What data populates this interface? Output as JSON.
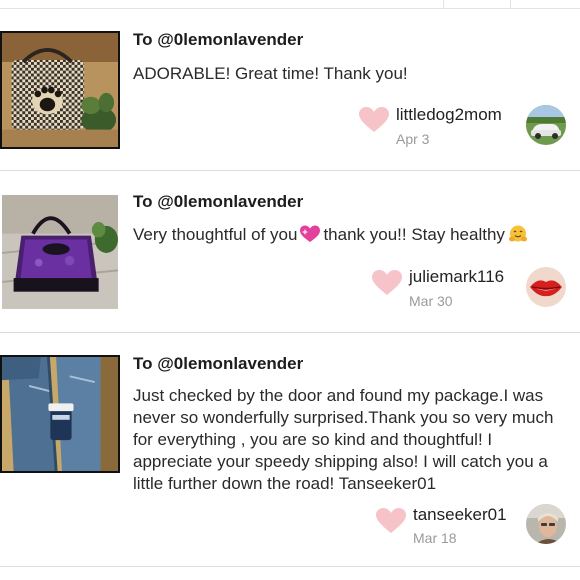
{
  "reviews": [
    {
      "to": "To @0lemonlavender",
      "message": "ADORABLE! Great time! Thank you!",
      "username": "littledog2mom",
      "date": "Apr 3",
      "thumbnail_icon": "houndstooth-paw-bag-photo",
      "avatar_icon": "white-car-photo"
    },
    {
      "to": "To @0lemonlavender",
      "message_parts": [
        "Very thoughtful of you",
        "thank you!! Stay healthy"
      ],
      "emojis": [
        "sparkling-heart-emoji",
        "hugging-face-emoji"
      ],
      "username": "juliemark116",
      "date": "Mar 30",
      "thumbnail_icon": "purple-handbag-photo",
      "avatar_icon": "red-lips-photo"
    },
    {
      "to": "To @0lemonlavender",
      "message": "Just checked by the door and found my package.I was never so wonderfully surprised.Thank you so very much for everything , you are so kind and thoughtful! I appreciate your speedy shipping also! I will catch you a little further down the road! Tanseeker01",
      "username": "tanseeker01",
      "date": "Mar 18",
      "thumbnail_icon": "jeans-and-cup-photo",
      "avatar_icon": "person-portrait-photo"
    }
  ],
  "colors": {
    "heart": "#f6c3c8",
    "date": "#9a9a9a",
    "divider": "#dcdcdc",
    "text": "#222222"
  }
}
